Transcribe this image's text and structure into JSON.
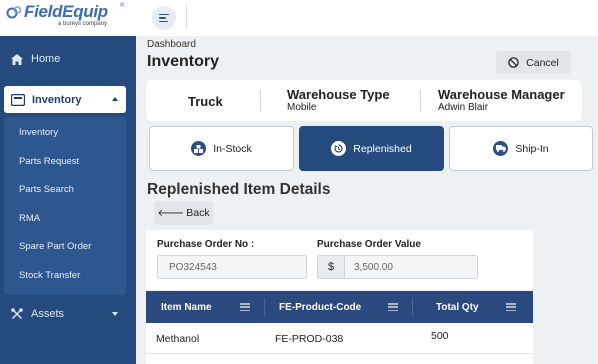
{
  "brand": {
    "name": "FieldEquip",
    "registered_mark": "®",
    "tagline": "a bureys company"
  },
  "sidebar": {
    "home_label": "Home",
    "inventory_label": "Inventory",
    "assets_label": "Assets",
    "submenu": [
      "Inventory",
      "Parts Request",
      "Parts Search",
      "RMA",
      "Spare Part Order",
      "Stock Transfer"
    ]
  },
  "header": {
    "breadcrumb": "Dashboard",
    "title": "Inventory",
    "cancel_label": "Cancel"
  },
  "info": {
    "type_name": "Truck",
    "warehouse_type_label": "Warehouse Type",
    "warehouse_type_value": "Mobile",
    "warehouse_manager_label": "Warehouse Manager",
    "warehouse_manager_value": "Adwin Blair"
  },
  "tabs": [
    {
      "label": "In-Stock",
      "active": false
    },
    {
      "label": "Replenished",
      "active": true
    },
    {
      "label": "Ship-In",
      "active": false
    }
  ],
  "details": {
    "section_title": "Replenished Item Details",
    "back_label": "Back",
    "back_arrow": "🡐",
    "po_number_label": "Purchase Order No :",
    "po_number_value": "PO324543",
    "po_value_label": "Purchase Order Value",
    "po_value_currency": "$",
    "po_value_amount": "3,500.00"
  },
  "table": {
    "columns": [
      "Item Name",
      "FE-Product-Code",
      "Total Qty"
    ],
    "rows": [
      {
        "item_name": "Methanol",
        "product_code": "FE-PROD-038",
        "total_qty": "500"
      }
    ]
  },
  "colors": {
    "sidebar": "#254a7e",
    "accent": "#254a7e",
    "table_header": "#2a4a7f"
  }
}
